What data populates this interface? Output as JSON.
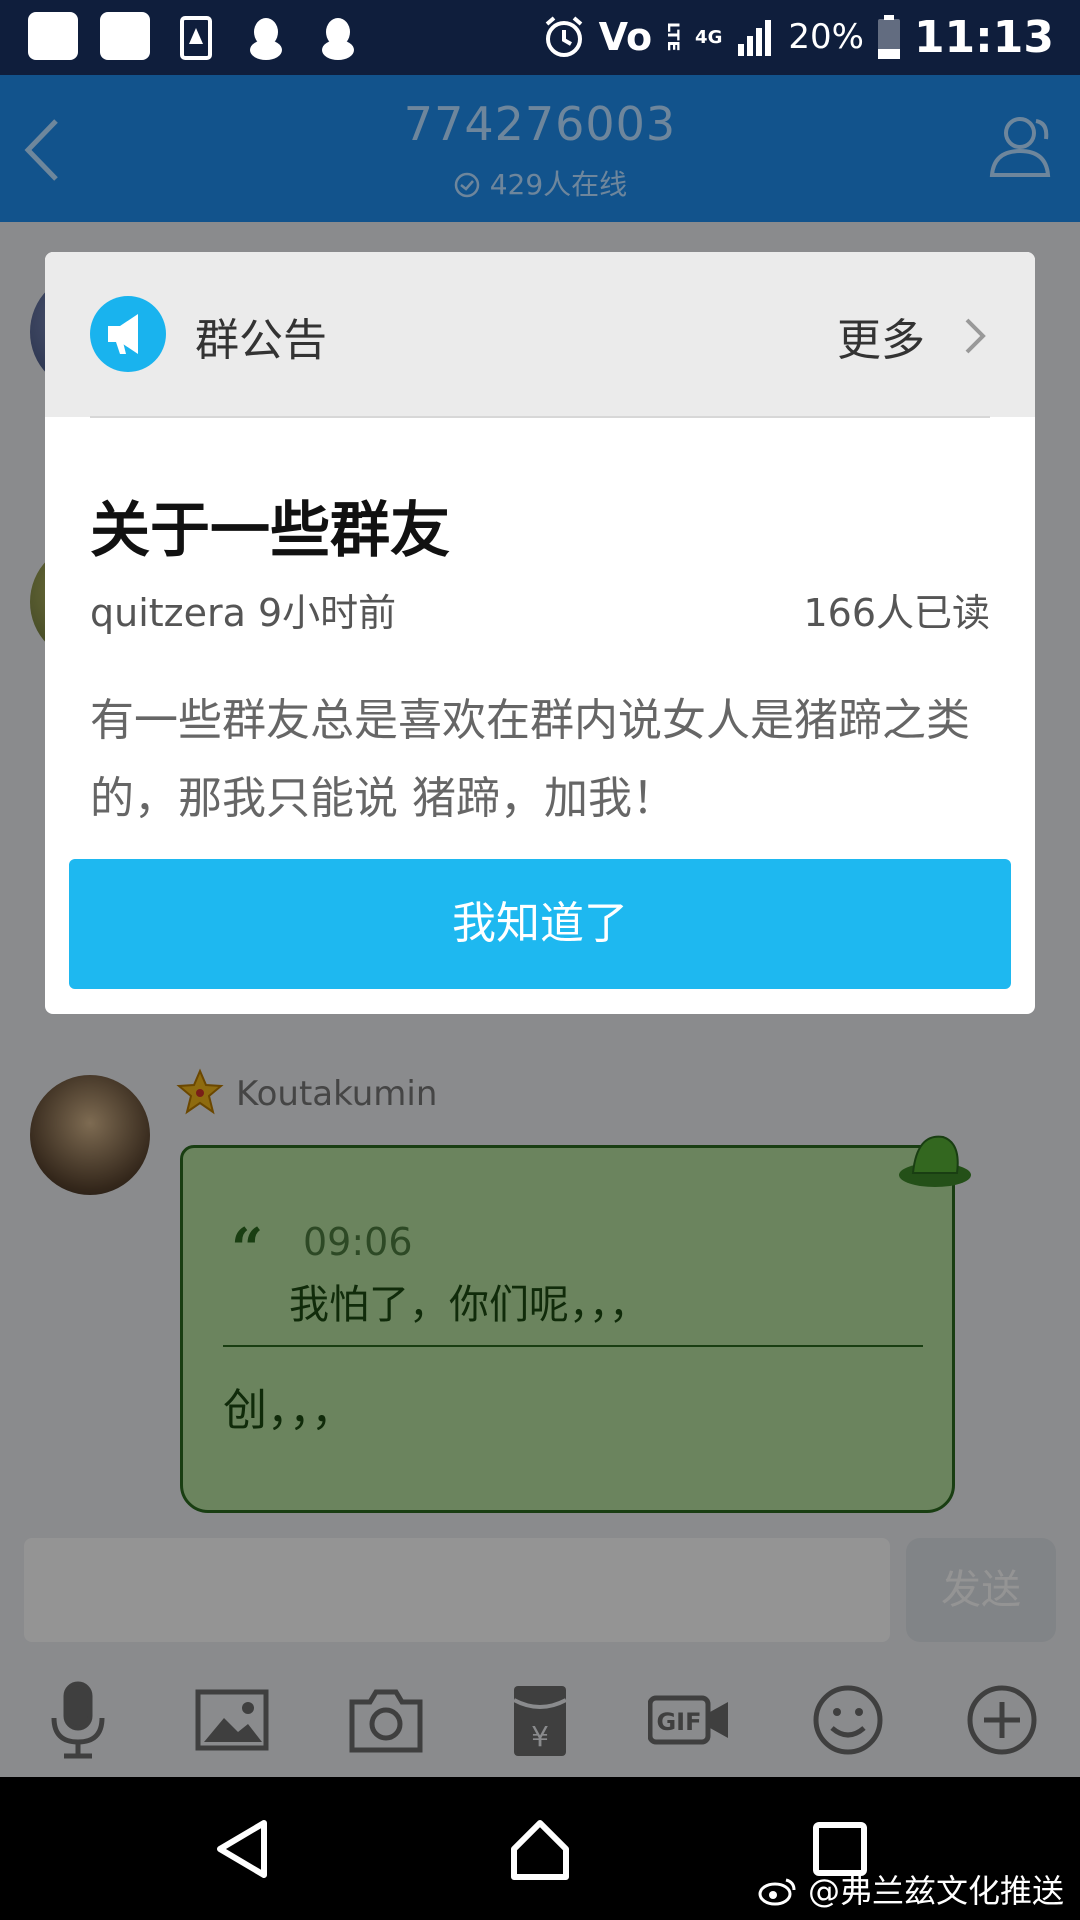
{
  "status_bar": {
    "network": "Vo",
    "lte": "LTE",
    "net4g": "4G",
    "battery": "20%",
    "time": "11:13"
  },
  "header": {
    "group_number": "774276003",
    "online": "429人在线"
  },
  "message": {
    "sender": "Koutakumin",
    "quote_time": "09:06",
    "quote_text": "我怕了，你们呢，，，",
    "reply": "创，，，"
  },
  "input": {
    "send_label": "发送"
  },
  "announcement": {
    "header_label": "群公告",
    "more_label": "更多",
    "title": "关于一些群友",
    "meta": "quitzera 9小时前",
    "read_count": "166人已读",
    "body": "有一些群友总是喜欢在群内说女人是猪蹄之类的，那我只能说 猪蹄，加我！",
    "confirm_label": "我知道了"
  },
  "toolbar": {
    "icons": [
      "microphone-icon",
      "image-icon",
      "camera-icon",
      "red-packet-icon",
      "gif-icon",
      "emoji-icon",
      "plus-icon"
    ]
  },
  "watermark": "@弗兰兹文化推送",
  "colors": {
    "title_bar": "#1d80d8",
    "accent": "#1eb8f0",
    "bubble": "#b9e3a3"
  }
}
